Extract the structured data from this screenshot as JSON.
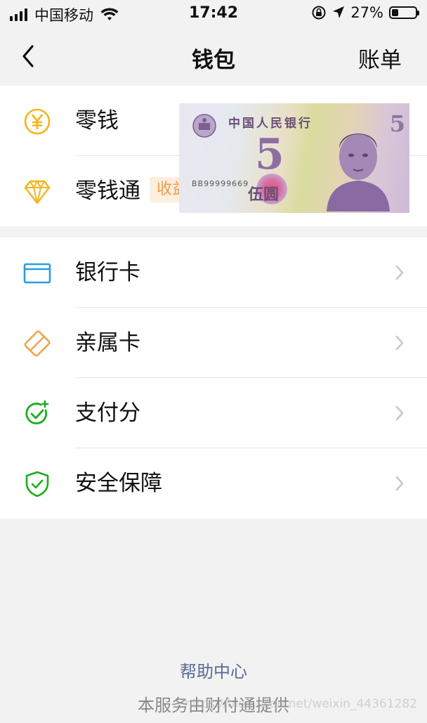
{
  "status_bar": {
    "carrier": "中国移动",
    "time": "17:42",
    "battery_percent": "27%",
    "battery_level": 0.27,
    "icons": [
      "signal-icon",
      "wifi-icon",
      "orientation-lock-icon",
      "location-icon",
      "battery-icon"
    ]
  },
  "nav": {
    "back_icon": "chevron-left-icon",
    "title": "钱包",
    "action_label": "账单"
  },
  "section_1": {
    "items": [
      {
        "label": "零钱",
        "icon": "yuan-coin-icon",
        "icon_color": "#f3b51b"
      },
      {
        "label": "零钱通",
        "icon": "diamond-icon",
        "icon_color": "#f3b51b",
        "badge": "收益"
      }
    ]
  },
  "banknote": {
    "header": "中国人民银行",
    "denomination": "5",
    "denomination_text": "伍圆",
    "serial": "BB99999669"
  },
  "section_2": {
    "items": [
      {
        "label": "银行卡",
        "icon": "bank-card-icon",
        "icon_color": "#2d9ce0"
      },
      {
        "label": "亲属卡",
        "icon": "family-card-icon",
        "icon_color": "#f0a448"
      },
      {
        "label": "支付分",
        "icon": "pay-score-icon",
        "icon_color": "#1aad19"
      },
      {
        "label": "安全保障",
        "icon": "shield-check-icon",
        "icon_color": "#1aad19"
      }
    ]
  },
  "footer": {
    "help_label": "帮助中心",
    "provider_text": "本服务由财付通提供",
    "watermark": "https://blog.csdn.net/weixin_44361282"
  },
  "colors": {
    "background": "#f2f2f2",
    "link": "#576b95",
    "accent_green": "#1aad19",
    "accent_yellow": "#f3b51b"
  }
}
